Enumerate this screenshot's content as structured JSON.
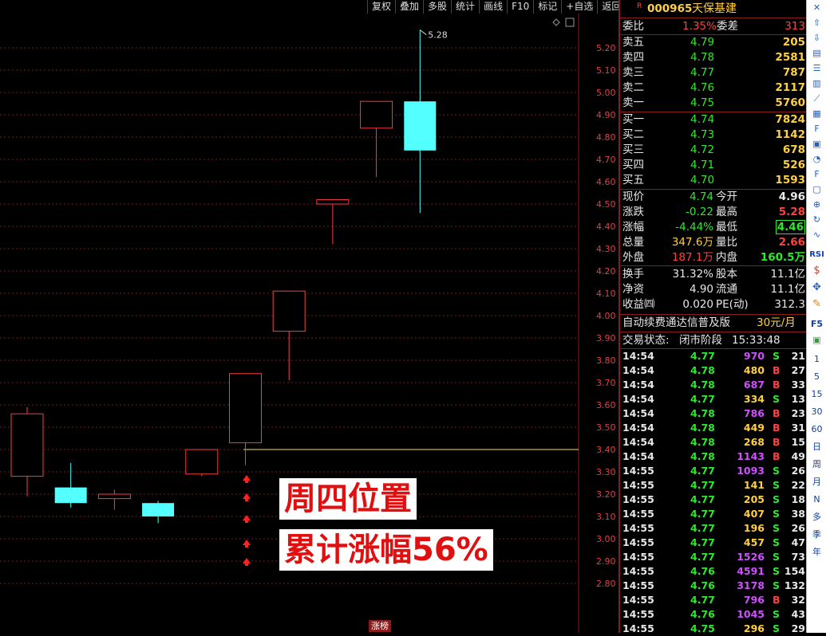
{
  "toolbar": [
    "复权",
    "叠加",
    "多股",
    "统计",
    "画线",
    "F10",
    "标记",
    "+自选",
    "返回"
  ],
  "chart": {
    "y_ticks": [
      "5.20",
      "5.10",
      "5.00",
      "4.90",
      "4.80",
      "4.70",
      "4.60",
      "4.50",
      "4.40",
      "4.30",
      "4.20",
      "4.10",
      "4.00",
      "3.90",
      "3.80",
      "3.70",
      "3.60",
      "3.50",
      "3.40",
      "3.30",
      "3.20",
      "3.10",
      "3.00",
      "2.90",
      "2.80"
    ],
    "high_label": "5.28",
    "bottom_tab": "涨榜",
    "overlay_line1": "周四位置",
    "overlay_line2": "累计涨幅56%",
    "ref_line": 3.4,
    "colors": {
      "up": "#ff3b3b",
      "down": "#54ffff",
      "grid": "#7a1c1c",
      "ref": "#ffe070"
    }
  },
  "chart_data": {
    "type": "candlestick",
    "ylim": [
      2.75,
      5.3
    ],
    "candles": [
      {
        "open": 3.28,
        "close": 3.56,
        "high": 3.59,
        "low": 3.19,
        "dir": "up"
      },
      {
        "open": 3.23,
        "close": 3.16,
        "high": 3.34,
        "low": 3.14,
        "dir": "down"
      },
      {
        "open": 3.2,
        "close": 3.18,
        "high": 3.22,
        "low": 3.13,
        "dir": "up"
      },
      {
        "open": 3.16,
        "close": 3.1,
        "high": 3.17,
        "low": 3.07,
        "dir": "down"
      },
      {
        "open": 3.29,
        "close": 3.4,
        "high": 3.4,
        "low": 3.28,
        "dir": "up"
      },
      {
        "open": 3.43,
        "close": 3.74,
        "high": 3.74,
        "low": 3.33,
        "dir": "up"
      },
      {
        "open": 3.93,
        "close": 4.11,
        "high": 4.11,
        "low": 3.71,
        "dir": "up"
      },
      {
        "open": 4.5,
        "close": 4.52,
        "high": 4.52,
        "low": 4.32,
        "dir": "up"
      },
      {
        "open": 4.84,
        "close": 4.96,
        "high": 4.96,
        "low": 4.62,
        "dir": "up"
      },
      {
        "open": 4.96,
        "close": 4.74,
        "high": 5.28,
        "low": 4.46,
        "dir": "down"
      }
    ]
  },
  "quote": {
    "title_marker": "R",
    "code": "000965",
    "name": "天保基建",
    "weibi_label": "委比",
    "weibi_value": "1.35%",
    "weicha_label": "委差",
    "weicha_value": "313",
    "sell": [
      {
        "label": "卖五",
        "price": "4.79",
        "vol": "205"
      },
      {
        "label": "卖四",
        "price": "4.78",
        "vol": "2581"
      },
      {
        "label": "卖三",
        "price": "4.77",
        "vol": "787"
      },
      {
        "label": "卖二",
        "price": "4.76",
        "vol": "2117"
      },
      {
        "label": "卖一",
        "price": "4.75",
        "vol": "5760"
      }
    ],
    "buy": [
      {
        "label": "买一",
        "price": "4.74",
        "vol": "7824"
      },
      {
        "label": "买二",
        "price": "4.73",
        "vol": "1142"
      },
      {
        "label": "买三",
        "price": "4.72",
        "vol": "678"
      },
      {
        "label": "买四",
        "price": "4.71",
        "vol": "526"
      },
      {
        "label": "买五",
        "price": "4.70",
        "vol": "1593"
      }
    ],
    "stats": [
      {
        "l1": "现价",
        "v1": "4.74",
        "c1": "green",
        "l2": "今开",
        "v2": "4.96",
        "c2": "white"
      },
      {
        "l1": "涨跌",
        "v1": "-0.22",
        "c1": "green",
        "l2": "最高",
        "v2": "5.28",
        "c2": "red"
      },
      {
        "l1": "涨幅",
        "v1": "-4.44%",
        "c1": "green",
        "l2": "最低",
        "v2": "4.46",
        "c2": "green"
      },
      {
        "l1": "总量",
        "v1": "347.6万",
        "c1": "yellow",
        "l2": "量比",
        "v2": "2.66",
        "c2": "red"
      },
      {
        "l1": "外盘",
        "v1": "187.1万",
        "c1": "red",
        "l2": "内盘",
        "v2": "160.5万",
        "c2": "green"
      }
    ],
    "stats2": [
      {
        "l1": "换手",
        "v1": "31.32%",
        "l2": "股本",
        "v2": "11.1亿"
      },
      {
        "l1": "净资",
        "v1": "4.90",
        "l2": "流通",
        "v2": "11.1亿"
      },
      {
        "l1": "收益㈣",
        "v1": "0.020",
        "l2": "PE(动)",
        "v2": "312.3"
      }
    ],
    "promo": "自动续费通达信普及版",
    "promo_price": "30元/月",
    "status_label": "交易状态:",
    "status_value": "闭市阶段",
    "status_time": "15:33:48"
  },
  "ticks": [
    {
      "t": "14:54",
      "p": "4.77",
      "v": "970",
      "d": "S",
      "n": "21",
      "vc": "purple"
    },
    {
      "t": "14:54",
      "p": "4.78",
      "v": "480",
      "d": "B",
      "n": "27",
      "vc": "yellow"
    },
    {
      "t": "14:54",
      "p": "4.78",
      "v": "687",
      "d": "B",
      "n": "33",
      "vc": "purple"
    },
    {
      "t": "14:54",
      "p": "4.77",
      "v": "334",
      "d": "S",
      "n": "13",
      "vc": "yellow"
    },
    {
      "t": "14:54",
      "p": "4.78",
      "v": "786",
      "d": "B",
      "n": "23",
      "vc": "purple"
    },
    {
      "t": "14:54",
      "p": "4.78",
      "v": "449",
      "d": "B",
      "n": "31",
      "vc": "yellow"
    },
    {
      "t": "14:54",
      "p": "4.78",
      "v": "268",
      "d": "B",
      "n": "15",
      "vc": "yellow"
    },
    {
      "t": "14:54",
      "p": "4.78",
      "v": "1143",
      "d": "B",
      "n": "49",
      "vc": "purple"
    },
    {
      "t": "14:55",
      "p": "4.77",
      "v": "1093",
      "d": "S",
      "n": "26",
      "vc": "purple"
    },
    {
      "t": "14:55",
      "p": "4.77",
      "v": "141",
      "d": "S",
      "n": "22",
      "vc": "yellow"
    },
    {
      "t": "14:55",
      "p": "4.77",
      "v": "205",
      "d": "S",
      "n": "18",
      "vc": "yellow"
    },
    {
      "t": "14:55",
      "p": "4.77",
      "v": "407",
      "d": "S",
      "n": "38",
      "vc": "yellow"
    },
    {
      "t": "14:55",
      "p": "4.77",
      "v": "196",
      "d": "S",
      "n": "26",
      "vc": "yellow"
    },
    {
      "t": "14:55",
      "p": "4.77",
      "v": "457",
      "d": "S",
      "n": "47",
      "vc": "yellow"
    },
    {
      "t": "14:55",
      "p": "4.77",
      "v": "1526",
      "d": "S",
      "n": "73",
      "vc": "purple"
    },
    {
      "t": "14:55",
      "p": "4.76",
      "v": "4591",
      "d": "S",
      "n": "154",
      "vc": "purple"
    },
    {
      "t": "14:55",
      "p": "4.76",
      "v": "3178",
      "d": "S",
      "n": "132",
      "vc": "purple"
    },
    {
      "t": "14:55",
      "p": "4.77",
      "v": "796",
      "d": "B",
      "n": "32",
      "vc": "purple"
    },
    {
      "t": "14:55",
      "p": "4.76",
      "v": "1045",
      "d": "S",
      "n": "43",
      "vc": "purple"
    },
    {
      "t": "14:55",
      "p": "4.75",
      "v": "296",
      "d": "S",
      "n": "29",
      "vc": "yellow"
    }
  ],
  "sidebar": {
    "icons": [
      "close-icon",
      "arrow-up-icon",
      "arrow-down-icon",
      "quote-icon",
      "list-icon",
      "kline-icon",
      "trend-icon",
      "table-icon",
      "f10-icon",
      "chart-icon",
      "pie-icon",
      "f12-icon",
      "window-icon",
      "zoom-icon",
      "refresh-icon",
      "wave-icon"
    ],
    "rsi": "RSI",
    "extra_icons": [
      "dollar-icon",
      "move-icon",
      "pen-icon"
    ],
    "f5": "F5",
    "periods": [
      "1",
      "5",
      "15",
      "30",
      "60",
      "日",
      "周",
      "月",
      "N",
      "多",
      "季",
      "年"
    ]
  }
}
